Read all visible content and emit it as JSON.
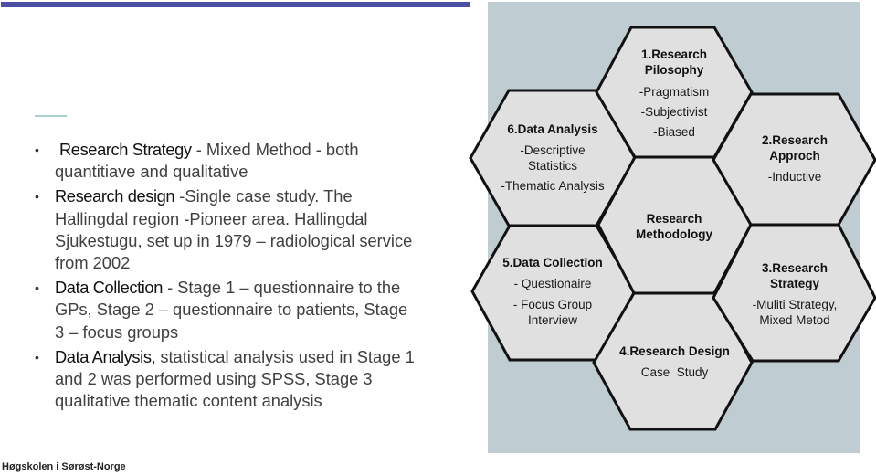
{
  "slide": {
    "bullets": [
      {
        "term": "Research Strategy",
        "text": " - Mixed Method - both quantitiave and qualitative"
      },
      {
        "term": "Research design",
        "text": " -Single case study. The Hallingdal region -Pioneer area. Hallingdal Sjukestugu, set up in 1979 – radiological service from 2002"
      },
      {
        "term": "Data Collection",
        "text": " - Stage 1 – questionnaire to the GPs, Stage 2 – questionnaire to patients, Stage 3 – focus groups"
      },
      {
        "term": "Data Analysis,",
        "text": " statistical analysis used in Stage 1 and 2 was performed using SPSS, Stage 3 qualitative thematic content analysis"
      }
    ],
    "bullet_glyph": "•",
    "footer": "Høgskolen i Sørøst-Norge"
  },
  "diagram": {
    "center": {
      "title_line1": "Research",
      "title_line2": "Methodology"
    },
    "hex1": {
      "title_line1": "1.Research",
      "title_line2": "Pilosophy",
      "items": [
        "-Pragmatism",
        "-Subjectivist",
        "-Biased"
      ]
    },
    "hex2": {
      "title_line1": "2.Research",
      "title_line2": "Approch",
      "items": [
        "-Inductive"
      ]
    },
    "hex3": {
      "title_line1": "3.Research",
      "title_line2": "Strategy",
      "item_line1": "-Muliti Strategy,",
      "item_line2": "Mixed Metod"
    },
    "hex4": {
      "title": "4.Research Design",
      "items": [
        "Case  Study"
      ]
    },
    "hex5": {
      "title": "5.Data Collection",
      "items": [
        "- Questionaire"
      ],
      "item_line1": "- Focus Group",
      "item_line2": "Interview"
    },
    "hex6": {
      "title": "6.Data Analysis",
      "item_line1": "-Descriptive",
      "item_line2": "Statistics",
      "items": [
        "-Thematic Analysis"
      ]
    },
    "colors": {
      "panel": "#bfcdd2",
      "hex_fill": "#e0e0e0",
      "hex_stroke": "#111111"
    }
  }
}
